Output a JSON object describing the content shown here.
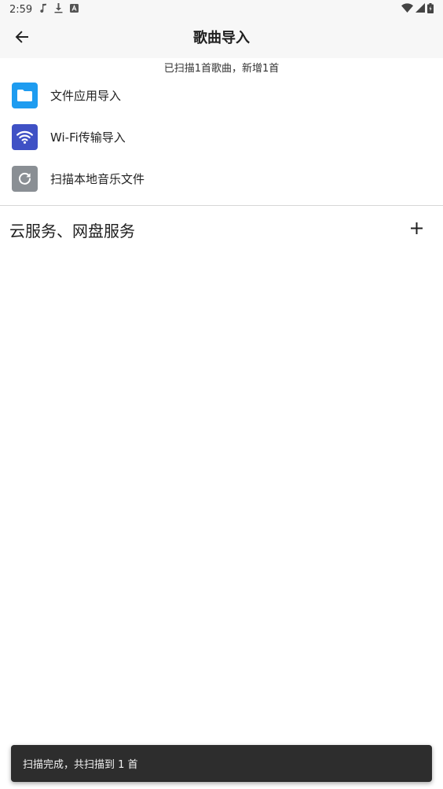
{
  "status_bar": {
    "time": "2:59",
    "icons": [
      "music-note-icon",
      "download-icon",
      "app-badge-icon",
      "wifi-icon",
      "cellular-icon",
      "battery-icon"
    ]
  },
  "app_bar": {
    "title": "歌曲导入",
    "back_icon": "arrow-back-icon"
  },
  "scan_summary": "已扫描1首歌曲，新增1首",
  "import_options": [
    {
      "label": "文件应用导入",
      "icon": "folder-icon",
      "color": "#1e9cf0"
    },
    {
      "label": "Wi-Fi传输导入",
      "icon": "wifi-icon",
      "color": "#3f51c5"
    },
    {
      "label": "扫描本地音乐文件",
      "icon": "refresh-icon",
      "color": "#8a8f94"
    }
  ],
  "cloud_section": {
    "title": "云服务、网盘服务",
    "add_icon": "plus-icon"
  },
  "snackbar": {
    "text": "扫描完成，共扫描到 1 首"
  }
}
